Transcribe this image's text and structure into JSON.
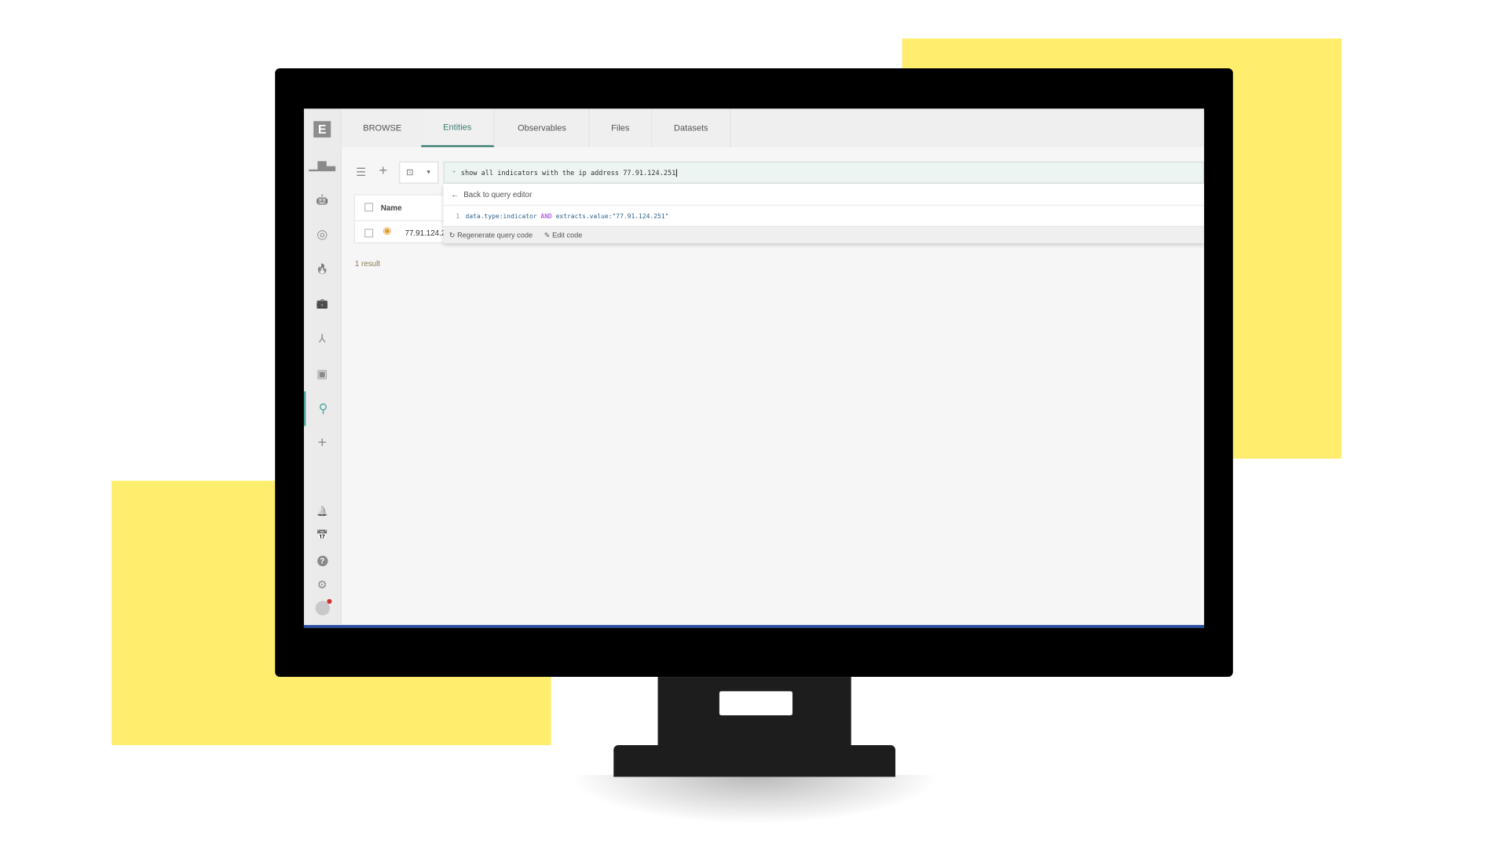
{
  "colors": {
    "accent": "#3c7d73",
    "highlight_yellow": "#ffed6e",
    "search_bg": "#edf5f3",
    "keyword": "#9b30d9"
  },
  "sidebar": {
    "logo": "E",
    "items": [
      {
        "icon": "bar-chart-icon",
        "glyph": "▁▆▃"
      },
      {
        "icon": "robot-icon",
        "glyph": "🤖"
      },
      {
        "icon": "target-icon",
        "glyph": "◎"
      },
      {
        "icon": "fire-alert-icon",
        "glyph": "🔥"
      },
      {
        "icon": "briefcase-icon",
        "glyph": "💼"
      },
      {
        "icon": "network-icon",
        "glyph": "⅄"
      },
      {
        "icon": "contacts-icon",
        "glyph": "▣"
      },
      {
        "icon": "search-icon",
        "glyph": "⚲",
        "active": true
      },
      {
        "icon": "plus-icon",
        "glyph": "+"
      }
    ],
    "bottom": [
      {
        "icon": "bell-icon",
        "glyph": "🔔"
      },
      {
        "icon": "calendar-icon",
        "glyph": "📅"
      },
      {
        "icon": "help-icon",
        "glyph": "?"
      },
      {
        "icon": "gear-icon",
        "glyph": "⚙"
      },
      {
        "icon": "avatar-icon",
        "glyph": "●"
      }
    ]
  },
  "tabs": [
    {
      "label": "BROWSE"
    },
    {
      "label": "Entities",
      "active": true
    },
    {
      "label": "Observables"
    },
    {
      "label": "Files"
    },
    {
      "label": "Datasets"
    }
  ],
  "toolbar": {
    "search_value": "show all indicators with the ip address 77.91.124.251"
  },
  "dropdown": {
    "back_label": "Back to query editor",
    "line_number": "1",
    "code_part1": "data.type:indicator",
    "code_keyword": "AND",
    "code_part2": "extracts.value:\"77.91.124.251\"",
    "regenerate_label": "Regenerate query code",
    "edit_label": "Edit code"
  },
  "table": {
    "header_name": "Name",
    "rows": [
      {
        "name": "77.91.124.2"
      }
    ]
  },
  "result_count": "1 result"
}
